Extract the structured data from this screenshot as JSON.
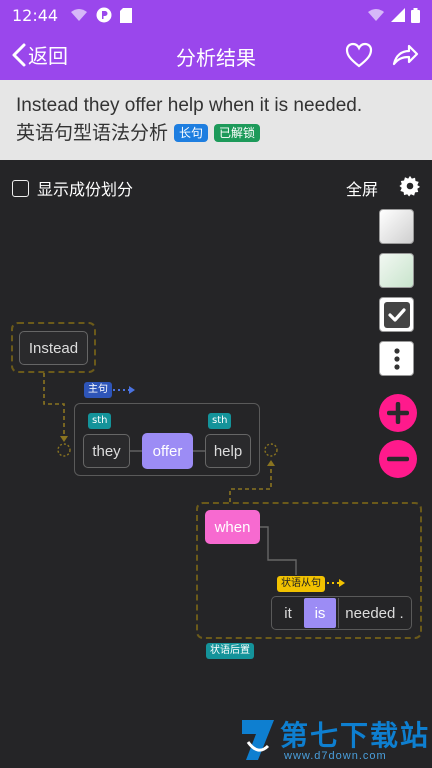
{
  "status_bar": {
    "time": "12:44"
  },
  "app_bar": {
    "back_label": "返回",
    "title": "分析结果"
  },
  "sentence": {
    "english": "Instead they offer help when it is needed.",
    "chinese": "英语句型语法分析",
    "badge_long": "长句",
    "badge_unlocked": "已解锁"
  },
  "options": {
    "show_components": "显示成份划分",
    "fullscreen": "全屏"
  },
  "diagram": {
    "instead": "Instead",
    "main_clause_tag": "主句",
    "sth_tag_1": "sth",
    "sth_tag_2": "sth",
    "they": "they",
    "offer": "offer",
    "help": "help",
    "when": "when",
    "adverbial_clause_tag": "状语从句",
    "it": "it",
    "is": "is",
    "needed": "needed .",
    "postposed_adverbial_tag": "状语后置"
  },
  "colors": {
    "accent": "#9a47ec",
    "verb": "#9c8cf5",
    "conjunction": "#f76ad0",
    "tag_teal": "#14939a",
    "tag_blue": "#2e55b8",
    "tag_yellow": "#f2c200",
    "add_remove": "#ff1a8c"
  },
  "watermark": {
    "brand": "第七下载站",
    "url": "www.d7down.com"
  }
}
